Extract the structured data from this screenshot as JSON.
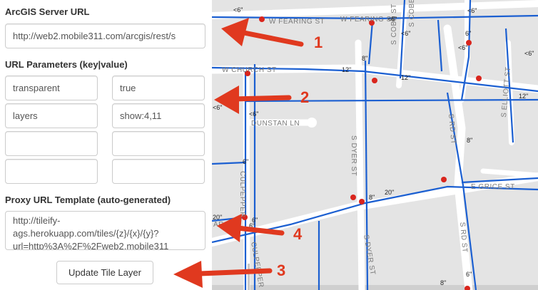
{
  "form": {
    "server_url_label": "ArcGIS Server URL",
    "server_url_value": "http://web2.mobile311.com/arcgis/rest/s",
    "url_params_label": "URL Parameters (key|value)",
    "params": [
      {
        "key": "transparent",
        "value": "true"
      },
      {
        "key": "layers",
        "value": "show:4,11"
      },
      {
        "key": "",
        "value": ""
      },
      {
        "key": "",
        "value": ""
      }
    ],
    "proxy_label": "Proxy URL Template (auto-generated)",
    "proxy_value": "http://tileify-ags.herokuapp.com/tiles/{z}/{x}/{y}?url=http%3A%2F%2Fweb2.mobile311",
    "update_button": "Update Tile Layer"
  },
  "annotations": {
    "a1": "1",
    "a2": "2",
    "a3": "3",
    "a4": "4"
  },
  "map": {
    "street_labels": [
      "W FEARING ST",
      "W FEARING ST",
      "S COBB ST",
      "S COBB ST",
      "W CHURCH ST",
      "DUNSTAN LN",
      "S DYER ST",
      "S DYER ST",
      "CULPEPPER",
      "CULPEPPER",
      "S RD ST",
      "S RD ST",
      "S ELLIOTT ST",
      "E GRICE ST",
      "ARCE"
    ],
    "pipe_labels": [
      "<6\"",
      "<6\"",
      "<6\"",
      "<6\"",
      "<6\"",
      "<6\"",
      "<6\"",
      "<6\"",
      "6\"",
      "6\"",
      "8\"",
      "8\"",
      "8\"",
      "12\"",
      "12\"",
      "12\"",
      "20\"",
      "20\"",
      "6\"",
      "6\"",
      "6\"",
      "8\""
    ],
    "colors": {
      "background": "#e4e4e4",
      "pipe": "#1b5fd1",
      "road": "#ffffff",
      "hydrant": "#d9251d",
      "annotation": "#e0391f"
    }
  }
}
